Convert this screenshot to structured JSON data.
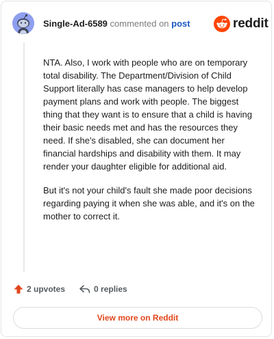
{
  "header": {
    "username": "Single-Ad-6589",
    "commented_on": "commented on",
    "post_link": "post"
  },
  "brand": {
    "name": "reddit",
    "color": "#ff4500"
  },
  "comment": {
    "paragraphs": [
      "NTA. Also, I work with people who are on temporary total disability. The Department/Division of Child Support literally has case managers to help develop payment plans and work with people. The biggest thing that they want is to ensure that a child is having their basic needs met and has the resources they need. If she's disabled, she can document her financial hardships and disability with them. It may render your daughter eligible for additional aid.",
      "But it's not your child's fault she made poor decisions regarding paying it when she was able, and it's on the mother to correct it."
    ]
  },
  "actions": {
    "upvotes": "2 upvotes",
    "replies": "0 replies"
  },
  "footer": {
    "view_more": "View more on Reddit",
    "accent_color": "#e0461b"
  },
  "icons": {
    "avatar": "snoo-avatar-icon",
    "upvote": "upvote-arrow-icon",
    "reply": "reply-arrow-icon",
    "brand": "reddit-snoo-icon"
  }
}
